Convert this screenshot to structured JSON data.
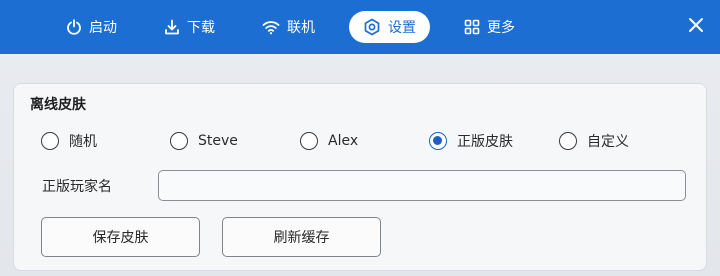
{
  "nav": {
    "launch_label": "启动",
    "download_label": "下载",
    "online_label": "联机",
    "settings_label": "设置",
    "more_label": "更多"
  },
  "colors": {
    "accent": "#1d6ed2",
    "radio_checked": "#1d5fc4"
  },
  "skin": {
    "section_title": "离线皮肤",
    "options": [
      "随机",
      "Steve",
      "Alex",
      "正版皮肤",
      "自定义"
    ],
    "selected": "正版皮肤",
    "player_name_label": "正版玩家名",
    "player_name_value": "",
    "save_button": "保存皮肤",
    "refresh_button": "刷新缓存"
  },
  "icons": {
    "launch": "power-icon",
    "download": "download-icon",
    "online": "wifi-icon",
    "settings": "gear-icon",
    "more": "grid-icon",
    "close": "close-icon"
  }
}
